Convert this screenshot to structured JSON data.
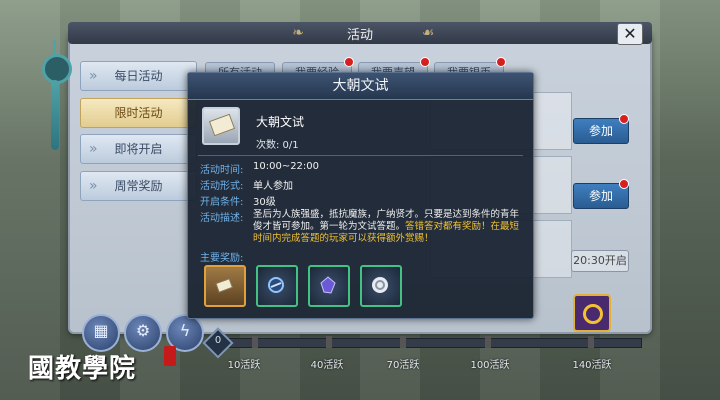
{
  "window": {
    "title": "活动",
    "close_label": "✕"
  },
  "sidebar": {
    "items": [
      {
        "label": "每日活动",
        "active": false
      },
      {
        "label": "限时活动",
        "active": true
      },
      {
        "label": "即将开启",
        "active": false
      },
      {
        "label": "周常奖励",
        "active": false
      }
    ]
  },
  "category_tabs": [
    {
      "label": "所有活动"
    },
    {
      "label": "我要经验"
    },
    {
      "label": "我要声望"
    },
    {
      "label": "我要银币"
    }
  ],
  "rows": {
    "join_label": "参加",
    "time_label": "20:30开启"
  },
  "popup": {
    "title": "大朝文试",
    "item_name": "大朝文试",
    "count": "次数: 0/1",
    "fields": [
      {
        "label": "活动时间:",
        "value": "10:00~22:00"
      },
      {
        "label": "活动形式:",
        "value": "单人参加"
      },
      {
        "label": "开启条件:",
        "value": "30级"
      }
    ],
    "desc_label": "活动描述:",
    "desc_text": "圣后为人族强盛，抵抗魔族，广纳贤才。只要是达到条件的青年俊才皆可参加。第一轮为文试答题。",
    "desc_highlight": "答错答对都有奖励！在最短时间内完成答题的玩家可以获得额外赏赐！",
    "reward_label": "主要奖励:",
    "rewards": [
      "scroll-icon",
      "compass-icon",
      "crystal-icon",
      "swirl-icon"
    ]
  },
  "progress": {
    "current": "0",
    "milestones": [
      "10活跃",
      "40活跃",
      "70活跃",
      "100活跃",
      "140活跃"
    ]
  },
  "watermark": "國教學院",
  "colors": {
    "accent_blue": "#6fb2ea",
    "highlight": "#f2c233",
    "reward_border": "#43c283"
  }
}
